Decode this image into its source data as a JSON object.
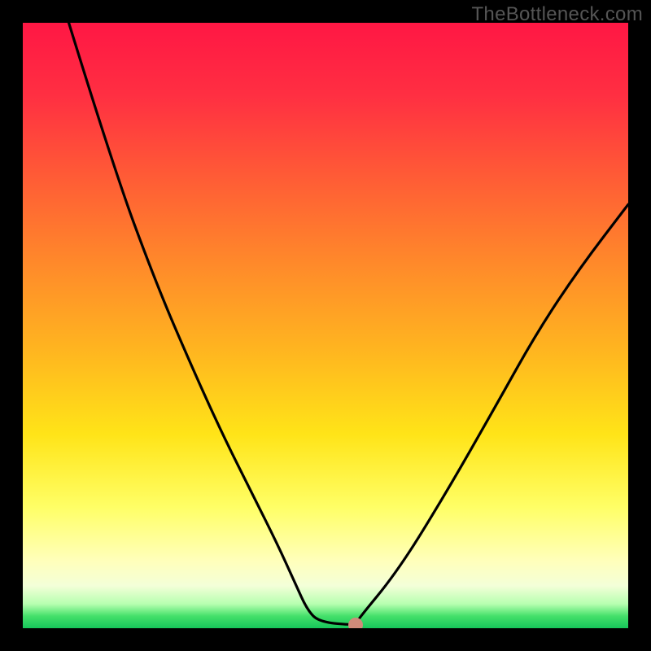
{
  "watermark": "TheBottleneck.com",
  "chart_data": {
    "type": "line",
    "title": "",
    "xlabel": "",
    "ylabel": "",
    "xlim": [
      0,
      1
    ],
    "ylim": [
      0,
      1
    ],
    "series": [
      {
        "name": "left-curve",
        "x": [
          0.076,
          0.15,
          0.22,
          0.28,
          0.33,
          0.38,
          0.42,
          0.45,
          0.47,
          0.49
        ],
        "y": [
          1.0,
          0.76,
          0.57,
          0.43,
          0.32,
          0.22,
          0.14,
          0.074,
          0.03,
          0.01
        ]
      },
      {
        "name": "trough-flat",
        "x": [
          0.49,
          0.55
        ],
        "y": [
          0.01,
          0.005
        ]
      },
      {
        "name": "right-curve",
        "x": [
          0.55,
          0.62,
          0.7,
          0.78,
          0.85,
          0.92,
          1.0
        ],
        "y": [
          0.01,
          0.095,
          0.225,
          0.365,
          0.49,
          0.595,
          0.7
        ]
      }
    ],
    "marker": {
      "x": 0.55,
      "y": 0.005,
      "color": "#cf8b7a"
    },
    "gradient_stops": [
      {
        "pos": 0.0,
        "color": "#ff1744"
      },
      {
        "pos": 0.4,
        "color": "#ff8a2a"
      },
      {
        "pos": 0.68,
        "color": "#ffe418"
      },
      {
        "pos": 0.89,
        "color": "#ffffbc"
      },
      {
        "pos": 0.96,
        "color": "#b7ffb0"
      },
      {
        "pos": 1.0,
        "color": "#16c65a"
      }
    ]
  }
}
